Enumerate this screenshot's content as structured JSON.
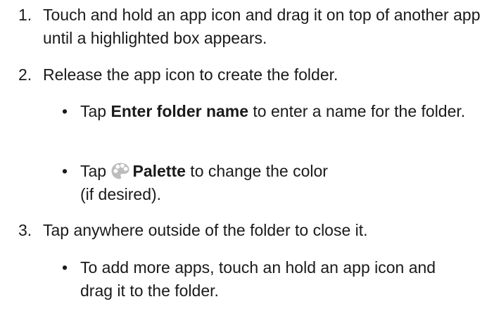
{
  "steps": [
    {
      "number": "1.",
      "text": "Touch and hold an app icon and drag it on top of another app until a highlighted box appears."
    },
    {
      "number": "2.",
      "text": "Release the app icon to create the folder.",
      "bullets": [
        {
          "prefix": "Tap ",
          "bold": "Enter folder name",
          "suffix": " to enter a name for the folder."
        },
        {
          "prefix": "Tap ",
          "icon": "palette-icon",
          "bold": "Palette",
          "suffix": " to change the color",
          "line2": "(if desired)."
        }
      ]
    },
    {
      "number": "3.",
      "text": "Tap anywhere outside of the folder to close it.",
      "bullets": [
        {
          "text": "To add more apps, touch an hold an app icon and drag it to the folder."
        }
      ]
    }
  ],
  "bullet_glyph": "•"
}
